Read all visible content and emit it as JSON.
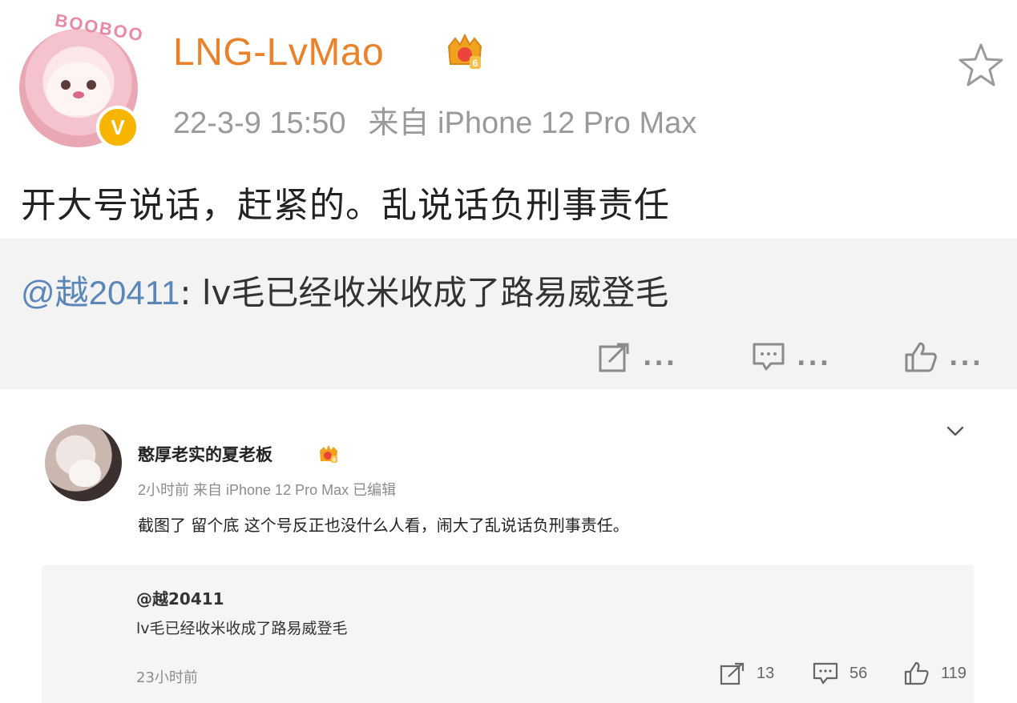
{
  "post_main": {
    "username": "LNG-LvMao",
    "level_badge": "6",
    "date": "22-3-9 15:50",
    "source": "来自 iPhone 12 Pro Max",
    "text": "开大号说话，赶紧的。乱说话负刑事责任",
    "repost": {
      "mention": "@越20411",
      "text": ": lv毛已经收米收成了路易威登毛"
    },
    "actions": {
      "share_count": "...",
      "comment_count": "...",
      "like_count": "..."
    },
    "icons": [
      "star-icon",
      "share-icon",
      "comment-icon",
      "like-icon",
      "verified-icon",
      "crown-icon"
    ]
  },
  "post_reply": {
    "username": "憨厚老实的夏老板",
    "level_badge": "6",
    "meta": "2小时前 来自 iPhone 12 Pro Max 已编辑",
    "text": "截图了 留个底 这个号反正也没什么人看，闹大了乱说话负刑事责任。",
    "repost": {
      "mention": "@越20411",
      "text": "lv毛已经收米收成了路易威登毛",
      "time": "23小时前",
      "actions": {
        "share_count": "13",
        "comment_count": "56",
        "like_count": "119"
      }
    }
  },
  "colors": {
    "username_orange": "#e8832b",
    "mention_blue": "#5a86b8",
    "meta_gray": "#9a9a9a",
    "panel_gray": "#f3f3f3",
    "verified_yellow": "#f7b500"
  }
}
